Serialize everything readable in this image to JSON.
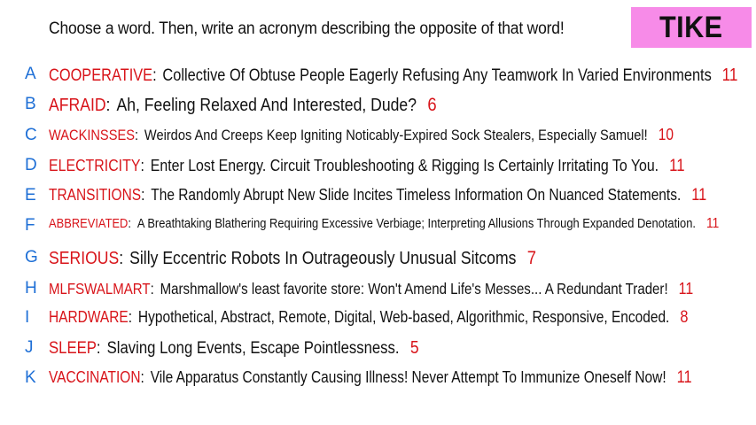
{
  "prompt": "Choose a word. Then, write an acronym describing the opposite of that word!",
  "logo": "TIKE",
  "colors": {
    "letter": "#1e6fd6",
    "word": "#d8141a",
    "count": "#d8141a",
    "logo_bg": "#f78be8"
  },
  "entries": [
    {
      "letter": "A",
      "word": "COOPERATIVE",
      "acronym": "Collective Of Obtuse People Eagerly Refusing Any Teamwork In Varied Environments",
      "count": "11"
    },
    {
      "letter": "B",
      "word": "AFRAID",
      "acronym": "Ah, Feeling Relaxed And Interested, Dude?",
      "count": "6"
    },
    {
      "letter": "C",
      "word": "WACKINSSES",
      "acronym": "Weirdos And Creeps Keep Igniting Noticably-Expired Sock Stealers, Especially Samuel!",
      "count": "10"
    },
    {
      "letter": "D",
      "word": "ELECTRICITY",
      "acronym": "Enter Lost Energy. Circuit Troubleshooting & Rigging Is Certainly Irritating To You.",
      "count": "11"
    },
    {
      "letter": "E",
      "word": "TRANSITIONS",
      "acronym": "The Randomly Abrupt New Slide Incites Timeless Information On Nuanced Statements.",
      "count": "11"
    },
    {
      "letter": "F",
      "word": "ABBREVIATED",
      "acronym": "A Breathtaking Blathering Requiring Excessive Verbiage; Interpreting Allusions Through Expanded Denotation.",
      "count": "11"
    },
    {
      "letter": "G",
      "word": "SERIOUS",
      "acronym": "Silly Eccentric Robots In Outrageously Unusual Sitcoms",
      "count": "7"
    },
    {
      "letter": "H",
      "word": "MLFSWALMART",
      "acronym": "Marshmallow's least favorite store: Won't Amend Life's Messes... A Redundant Trader!",
      "count": "11"
    },
    {
      "letter": "I",
      "word": "HARDWARE",
      "acronym": "Hypothetical, Abstract, Remote, Digital, Web-based, Algorithmic, Responsive, Encoded.",
      "count": "8"
    },
    {
      "letter": "J",
      "word": "SLEEP",
      "acronym": "Slaving Long Events, Escape Pointlessness.",
      "count": "5"
    },
    {
      "letter": "K",
      "word": "VACCINATION",
      "acronym": "Vile Apparatus Constantly Causing Illness! Never Attempt To Immunize Oneself Now!",
      "count": "11"
    }
  ]
}
